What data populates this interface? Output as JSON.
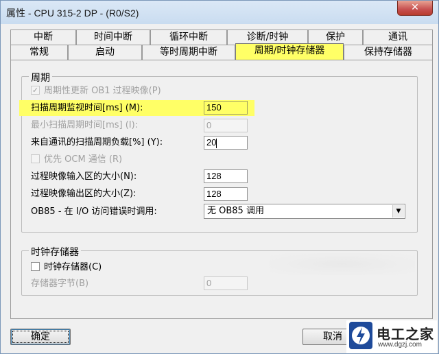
{
  "window": {
    "title": "属性 - CPU 315-2 DP - (R0/S2)",
    "close_label": "✕"
  },
  "tabs": {
    "row1": [
      {
        "label": "中断"
      },
      {
        "label": "时间中断"
      },
      {
        "label": "循环中断"
      },
      {
        "label": "诊断/时钟"
      },
      {
        "label": "保护"
      },
      {
        "label": "通讯"
      }
    ],
    "row2": [
      {
        "label": "常规"
      },
      {
        "label": "启动"
      },
      {
        "label": "等时周期中断"
      },
      {
        "label": "周期/时钟存储器"
      },
      {
        "label": "保持存储器"
      }
    ]
  },
  "cycle_group": {
    "title": "周期",
    "periodic_update_label": "周期性更新 OB1 过程映像(P)",
    "scan_monitor_label": "扫描周期监视时间[ms] (M):",
    "scan_monitor_value": "150",
    "min_scan_label": "最小扫描周期时间[ms] (I):",
    "min_scan_value": "0",
    "comm_load_label": "来自通讯的扫描周期负载[%] (Y):",
    "comm_load_value": "20",
    "priority_ocm_label": "优先 OCM 通信 (R)",
    "pi_input_label": "过程映像输入区的大小(N):",
    "pi_input_value": "128",
    "pi_output_label": "过程映像输出区的大小(Z):",
    "pi_output_value": "128",
    "ob85_label": "OB85 - 在 I/O 访问错误时调用:",
    "ob85_value": "无 OB85 调用"
  },
  "clock_group": {
    "title": "时钟存储器",
    "clock_mem_label": "时钟存储器(C)",
    "mem_byte_label": "存储器字节(B)",
    "mem_byte_value": "0"
  },
  "buttons": {
    "ok": "确定",
    "cancel": "取消"
  },
  "watermark": {
    "title": "电工之家",
    "url": "www.dgzj.com"
  }
}
